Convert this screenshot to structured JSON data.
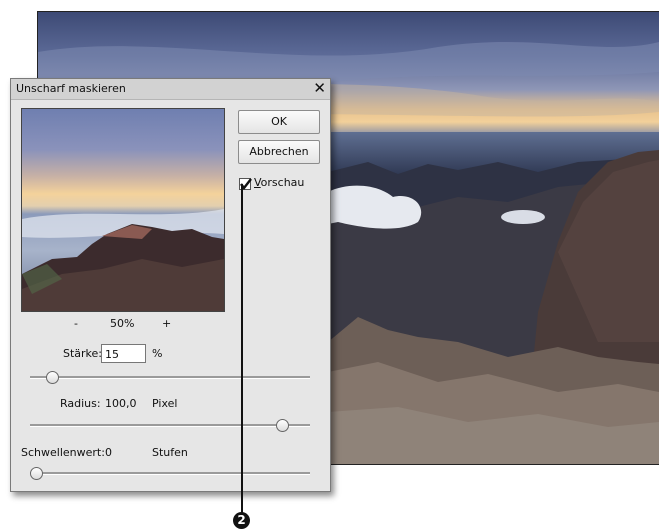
{
  "dialog": {
    "title": "Unscharf maskieren",
    "close_glyph": "✕",
    "preview": {
      "zoom_out": "-",
      "zoom_value": "50%",
      "zoom_in": "+"
    },
    "buttons": {
      "ok": "OK",
      "cancel": "Abbrechen"
    },
    "preview_checkbox": {
      "label_underlined": "V",
      "label_rest": "orschau",
      "checked": true
    },
    "staerke": {
      "label": "Stärke:",
      "value": "15",
      "unit": "%",
      "slider_fraction": 0.06
    },
    "radius": {
      "label": "Radius:",
      "value": "100,0",
      "unit": "Pixel",
      "slider_fraction": 0.92
    },
    "schwellenwert": {
      "label": "Schwellenwert:",
      "value": "0",
      "unit": "Stufen",
      "slider_fraction": 0.0
    }
  },
  "callout": {
    "number": "2"
  },
  "icons": {
    "close": "close-icon",
    "checkmark": "checkmark-icon"
  }
}
